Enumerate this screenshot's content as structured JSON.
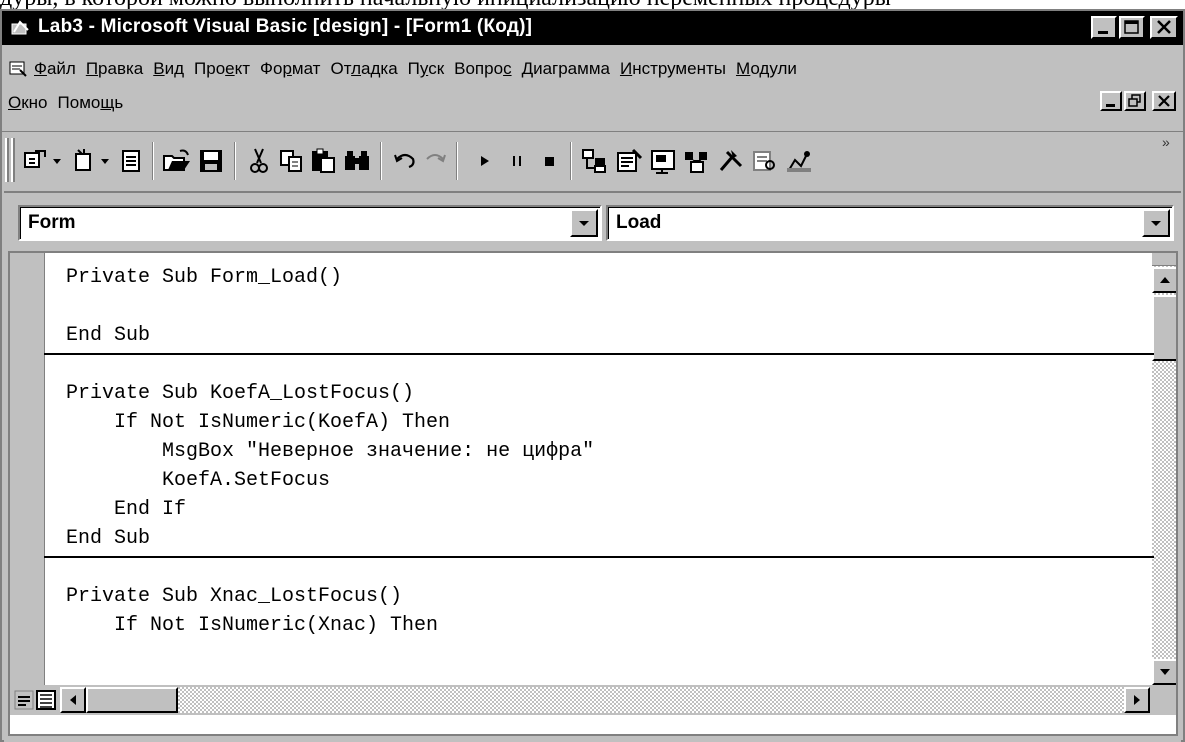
{
  "caption_fragment": "дуры, в которой можно выполнить начальную инициализацию переменных процедуры",
  "window": {
    "title": "Lab3 - Microsoft Visual Basic [design] - [Form1 (Код)]"
  },
  "menu": {
    "row1": [
      "Файл",
      "Правка",
      "Вид",
      "Проект",
      "Формат",
      "Отладка",
      "Пуск",
      "Вопрос",
      "Диаграмма",
      "Инструменты",
      "Модули"
    ],
    "row2": [
      "Окно",
      "Помощь"
    ],
    "underline_index": [
      0,
      0,
      0,
      3,
      2,
      2,
      1,
      5,
      0,
      0,
      0
    ]
  },
  "code_window": {
    "object_combo": "Form",
    "procedure_combo": "Load",
    "lines": [
      "Private Sub Form_Load()",
      "",
      "End Sub",
      "",
      "Private Sub KoefA_LostFocus()",
      "    If Not IsNumeric(KoefA) Then",
      "        MsgBox \"Неверное значение: не цифра\"",
      "        KoefA.SetFocus",
      "    End If",
      "End Sub",
      "",
      "Private Sub Xnac_LostFocus()",
      "    If Not IsNumeric(Xnac) Then"
    ],
    "separators_after_line": [
      2,
      9
    ]
  },
  "colors": {
    "titlebar": "#000000",
    "face": "#c0c0c0",
    "shadow": "#808080",
    "highlight": "#ffffff"
  }
}
